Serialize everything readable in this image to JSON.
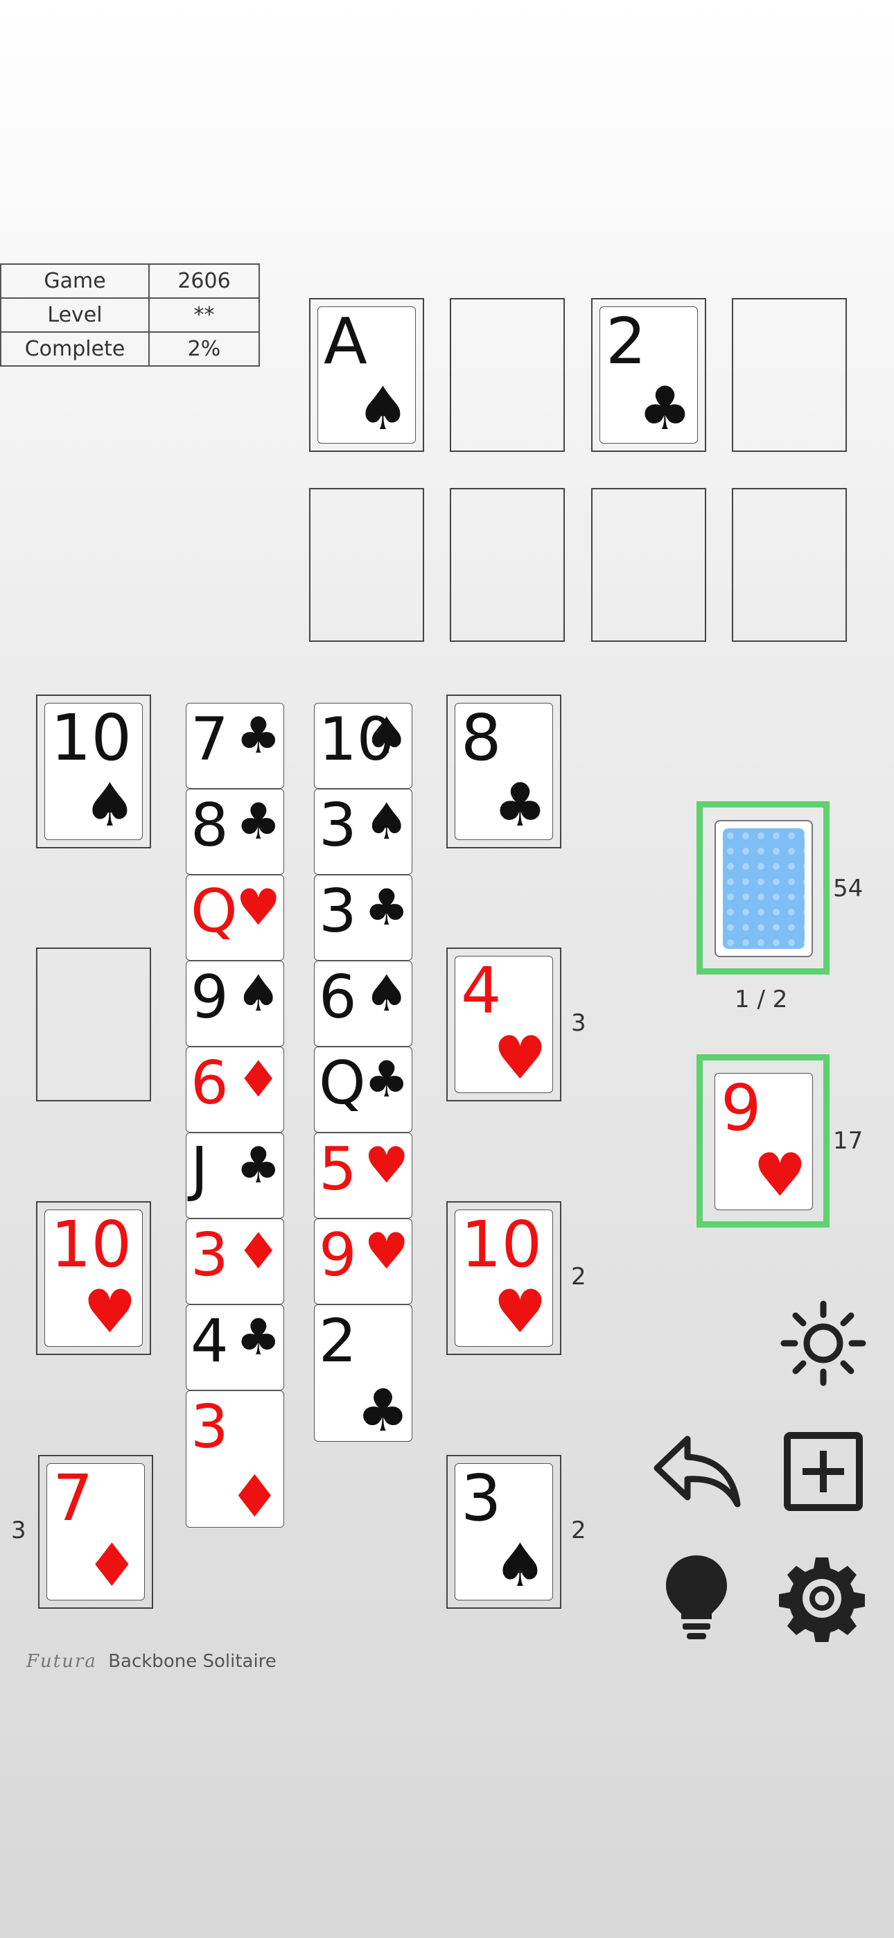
{
  "info": {
    "game_label": "Game",
    "game_value": "2606",
    "level_label": "Level",
    "level_value": "**",
    "complete_label": "Complete",
    "complete_value": "2%"
  },
  "foundations": [
    {
      "rank": "A",
      "suit": "♠",
      "color": "black"
    },
    null,
    {
      "rank": "2",
      "suit": "♣",
      "color": "black"
    },
    null
  ],
  "left_pile": [
    {
      "rank": "10",
      "suit": "♠"
    },
    {
      "rank": "10",
      "suit": "♥"
    },
    {
      "rank": "7",
      "suit": "♦"
    }
  ],
  "tableau_1": [
    {
      "rank": "7",
      "suit": "♣"
    },
    {
      "rank": "8",
      "suit": "♣"
    },
    {
      "rank": "Q",
      "suit": "♥"
    },
    {
      "rank": "9",
      "suit": "♠"
    },
    {
      "rank": "6",
      "suit": "♦"
    },
    {
      "rank": "J",
      "suit": "♣"
    },
    {
      "rank": "3",
      "suit": "♦"
    },
    {
      "rank": "4",
      "suit": "♣"
    },
    {
      "rank": "3",
      "suit": "♦"
    }
  ],
  "tableau_2": [
    {
      "rank": "10",
      "suit": "♠"
    },
    {
      "rank": "3",
      "suit": "♠"
    },
    {
      "rank": "3",
      "suit": "♣"
    },
    {
      "rank": "6",
      "suit": "♠"
    },
    {
      "rank": "Q",
      "suit": "♣"
    },
    {
      "rank": "5",
      "suit": "♥"
    },
    {
      "rank": "9",
      "suit": "♥"
    },
    {
      "rank": "2",
      "suit": "♣"
    }
  ],
  "right_pile": [
    {
      "rank": "8",
      "suit": "♣"
    },
    {
      "rank": "4",
      "suit": "♥"
    },
    {
      "rank": "10",
      "suit": "♥"
    },
    {
      "rank": "3",
      "suit": "♠"
    }
  ],
  "counts": {
    "left_7": "3",
    "right_4": "3",
    "right_10": "2",
    "right_3": "2",
    "stock": "54",
    "waste": "17",
    "round": "1 / 2"
  },
  "waste_card": {
    "rank": "9",
    "suit": "♥"
  },
  "footer": {
    "logo": "Futura",
    "text": "Backbone Solitaire"
  },
  "colors": {
    "red": "#ee1111",
    "black": "#111111",
    "highlight": "#5fd16f",
    "card_back": "#7fbef5"
  },
  "icons": [
    "brightness-icon",
    "undo-icon",
    "new-game-icon",
    "hint-icon",
    "settings-icon"
  ]
}
